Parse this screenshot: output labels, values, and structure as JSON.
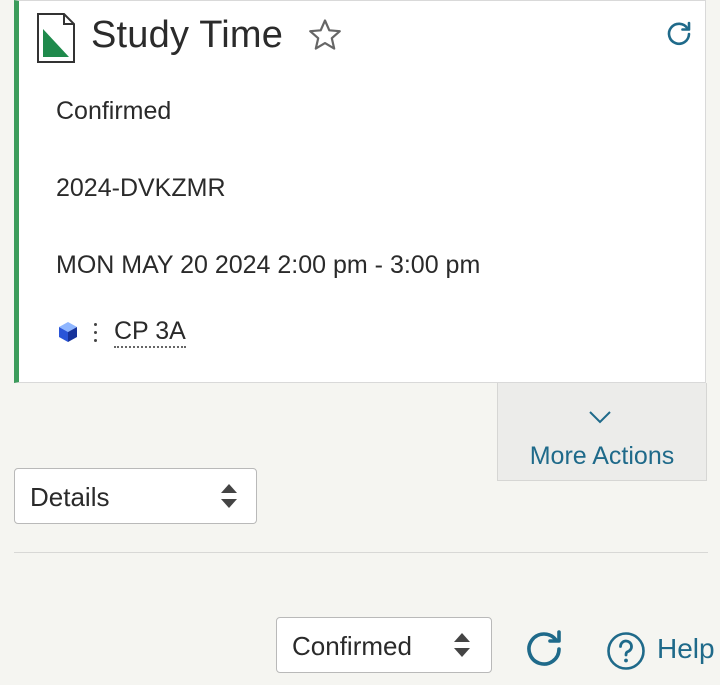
{
  "card": {
    "title": "Study Time",
    "status": "Confirmed",
    "code": "2024-DVKZMR",
    "when": "MON MAY 20 2024 2:00 pm - 3:00 pm",
    "location": "CP 3A"
  },
  "more_actions": {
    "label": "More Actions"
  },
  "details_select": {
    "value": "Details"
  },
  "status_select": {
    "value": "Confirmed"
  },
  "footer": {
    "help_label": "Help"
  },
  "colors": {
    "accent_green": "#3c9c5c",
    "link_blue": "#1f6a8a",
    "background": "#f5f5f1"
  },
  "icons": [
    "document-icon",
    "star-icon",
    "refresh-icon",
    "cube-icon",
    "kebab-icon",
    "chevron-down-icon",
    "updown-icon",
    "help-icon"
  ]
}
